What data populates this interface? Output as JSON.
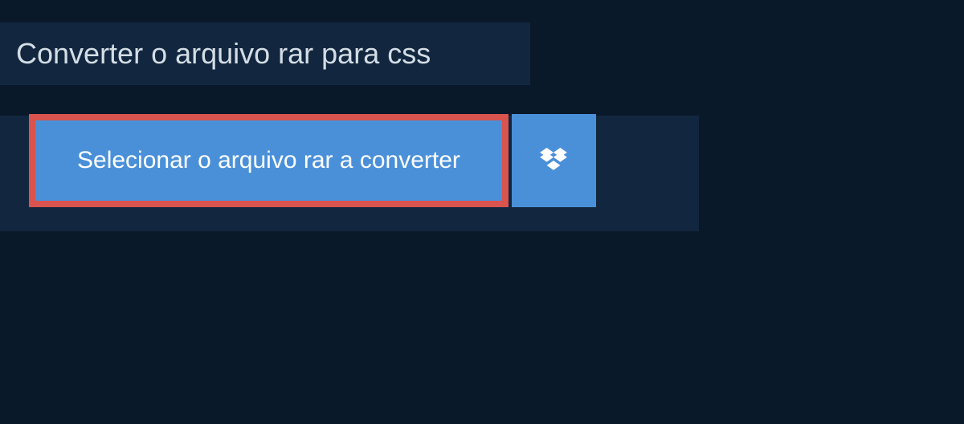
{
  "header": {
    "title": "Converter o arquivo rar para css"
  },
  "buttons": {
    "select_file_label": "Selecionar o arquivo rar a converter"
  },
  "colors": {
    "background": "#0a1929",
    "panel": "#12273f",
    "button_primary": "#4a90d9",
    "button_highlight_border": "#d9534f",
    "text_light": "#d4dde5",
    "text_white": "#ffffff"
  }
}
